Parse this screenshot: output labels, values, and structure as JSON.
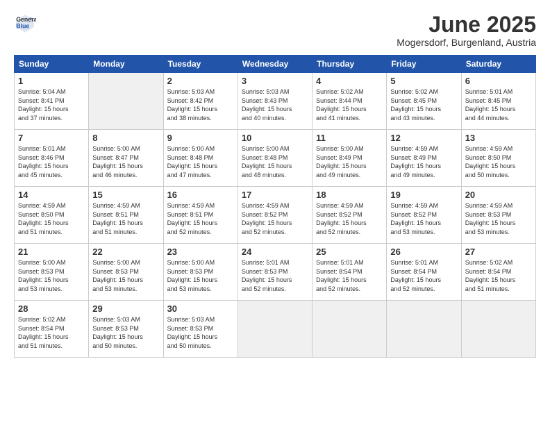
{
  "logo": {
    "general": "General",
    "blue": "Blue"
  },
  "title": "June 2025",
  "location": "Mogersdorf, Burgenland, Austria",
  "days_of_week": [
    "Sunday",
    "Monday",
    "Tuesday",
    "Wednesday",
    "Thursday",
    "Friday",
    "Saturday"
  ],
  "cells": [
    {
      "day": "",
      "info": ""
    },
    {
      "day": "2",
      "info": "Sunrise: 5:03 AM\nSunset: 8:42 PM\nDaylight: 15 hours\nand 38 minutes."
    },
    {
      "day": "3",
      "info": "Sunrise: 5:03 AM\nSunset: 8:43 PM\nDaylight: 15 hours\nand 40 minutes."
    },
    {
      "day": "4",
      "info": "Sunrise: 5:02 AM\nSunset: 8:44 PM\nDaylight: 15 hours\nand 41 minutes."
    },
    {
      "day": "5",
      "info": "Sunrise: 5:02 AM\nSunset: 8:45 PM\nDaylight: 15 hours\nand 43 minutes."
    },
    {
      "day": "6",
      "info": "Sunrise: 5:01 AM\nSunset: 8:45 PM\nDaylight: 15 hours\nand 44 minutes."
    },
    {
      "day": "7",
      "info": "Sunrise: 5:01 AM\nSunset: 8:46 PM\nDaylight: 15 hours\nand 45 minutes."
    },
    {
      "day": "8",
      "info": "Sunrise: 5:00 AM\nSunset: 8:47 PM\nDaylight: 15 hours\nand 46 minutes."
    },
    {
      "day": "9",
      "info": "Sunrise: 5:00 AM\nSunset: 8:48 PM\nDaylight: 15 hours\nand 47 minutes."
    },
    {
      "day": "10",
      "info": "Sunrise: 5:00 AM\nSunset: 8:48 PM\nDaylight: 15 hours\nand 48 minutes."
    },
    {
      "day": "11",
      "info": "Sunrise: 5:00 AM\nSunset: 8:49 PM\nDaylight: 15 hours\nand 49 minutes."
    },
    {
      "day": "12",
      "info": "Sunrise: 4:59 AM\nSunset: 8:49 PM\nDaylight: 15 hours\nand 49 minutes."
    },
    {
      "day": "13",
      "info": "Sunrise: 4:59 AM\nSunset: 8:50 PM\nDaylight: 15 hours\nand 50 minutes."
    },
    {
      "day": "14",
      "info": "Sunrise: 4:59 AM\nSunset: 8:50 PM\nDaylight: 15 hours\nand 51 minutes."
    },
    {
      "day": "15",
      "info": "Sunrise: 4:59 AM\nSunset: 8:51 PM\nDaylight: 15 hours\nand 51 minutes."
    },
    {
      "day": "16",
      "info": "Sunrise: 4:59 AM\nSunset: 8:51 PM\nDaylight: 15 hours\nand 52 minutes."
    },
    {
      "day": "17",
      "info": "Sunrise: 4:59 AM\nSunset: 8:52 PM\nDaylight: 15 hours\nand 52 minutes."
    },
    {
      "day": "18",
      "info": "Sunrise: 4:59 AM\nSunset: 8:52 PM\nDaylight: 15 hours\nand 52 minutes."
    },
    {
      "day": "19",
      "info": "Sunrise: 4:59 AM\nSunset: 8:52 PM\nDaylight: 15 hours\nand 53 minutes."
    },
    {
      "day": "20",
      "info": "Sunrise: 4:59 AM\nSunset: 8:53 PM\nDaylight: 15 hours\nand 53 minutes."
    },
    {
      "day": "21",
      "info": "Sunrise: 5:00 AM\nSunset: 8:53 PM\nDaylight: 15 hours\nand 53 minutes."
    },
    {
      "day": "22",
      "info": "Sunrise: 5:00 AM\nSunset: 8:53 PM\nDaylight: 15 hours\nand 53 minutes."
    },
    {
      "day": "23",
      "info": "Sunrise: 5:00 AM\nSunset: 8:53 PM\nDaylight: 15 hours\nand 53 minutes."
    },
    {
      "day": "24",
      "info": "Sunrise: 5:01 AM\nSunset: 8:53 PM\nDaylight: 15 hours\nand 52 minutes."
    },
    {
      "day": "25",
      "info": "Sunrise: 5:01 AM\nSunset: 8:54 PM\nDaylight: 15 hours\nand 52 minutes."
    },
    {
      "day": "26",
      "info": "Sunrise: 5:01 AM\nSunset: 8:54 PM\nDaylight: 15 hours\nand 52 minutes."
    },
    {
      "day": "27",
      "info": "Sunrise: 5:02 AM\nSunset: 8:54 PM\nDaylight: 15 hours\nand 51 minutes."
    },
    {
      "day": "28",
      "info": "Sunrise: 5:02 AM\nSunset: 8:54 PM\nDaylight: 15 hours\nand 51 minutes."
    },
    {
      "day": "29",
      "info": "Sunrise: 5:03 AM\nSunset: 8:53 PM\nDaylight: 15 hours\nand 50 minutes."
    },
    {
      "day": "30",
      "info": "Sunrise: 5:03 AM\nSunset: 8:53 PM\nDaylight: 15 hours\nand 50 minutes."
    },
    {
      "day": "",
      "info": ""
    },
    {
      "day": "",
      "info": ""
    },
    {
      "day": "",
      "info": ""
    },
    {
      "day": "",
      "info": ""
    },
    {
      "day": "",
      "info": ""
    }
  ],
  "first_day_cell": {
    "day": "1",
    "info": "Sunrise: 5:04 AM\nSunset: 8:41 PM\nDaylight: 15 hours\nand 37 minutes."
  }
}
